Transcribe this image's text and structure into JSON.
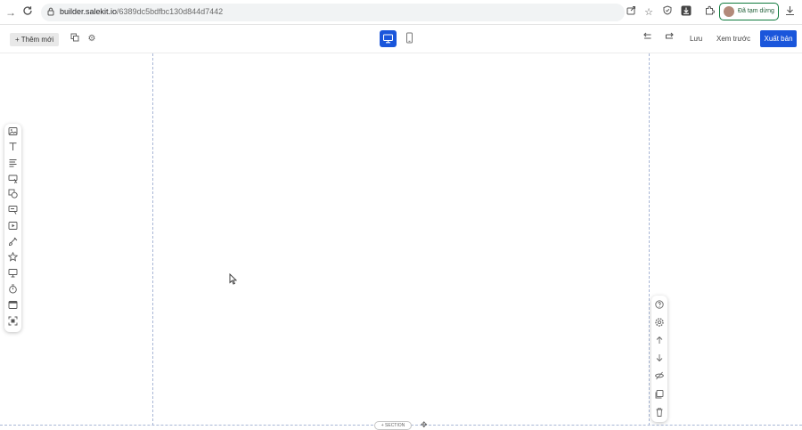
{
  "browser": {
    "url_host": "builder.salekit.io",
    "url_path": "/6389dc5bdfbc130d844d7442",
    "profile_status": "Đã tạm dừng"
  },
  "toolbar": {
    "add_label": "+ Thêm mới",
    "save_label": "Lưu",
    "preview_label": "Xem trước",
    "publish_label": "Xuất bản"
  },
  "canvas": {
    "section_label": "+ SECTION"
  },
  "colors": {
    "accent": "#1a56db",
    "guide": "#a8b7d6"
  }
}
